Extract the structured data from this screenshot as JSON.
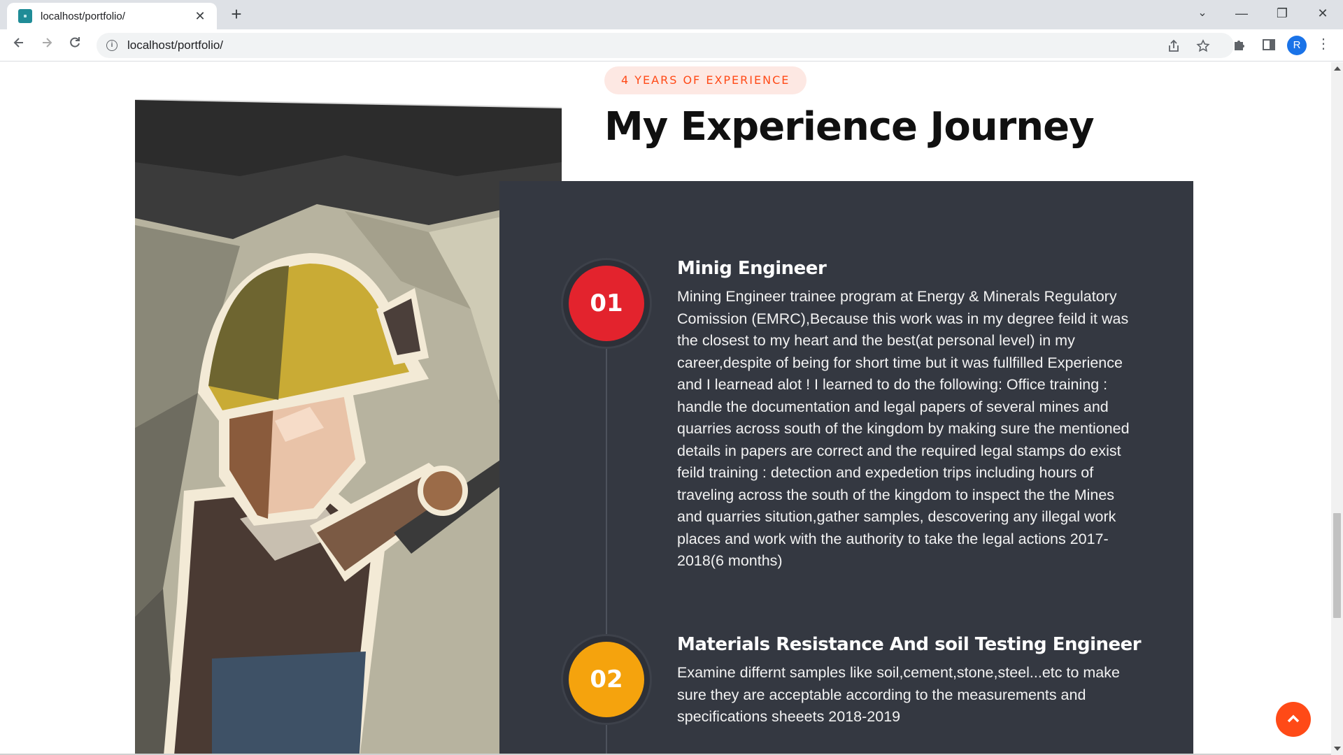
{
  "browser": {
    "tab_title": "localhost/portfolio/",
    "tab_close": "✕",
    "new_tab": "+",
    "url": "localhost/portfolio/",
    "profile_initial": "R",
    "controls": {
      "minimize": "—",
      "restore": "❐",
      "close": "✕",
      "tab_search": "⌄"
    }
  },
  "section": {
    "eyebrow": "4 YEARS OF EXPERIENCE",
    "title": "My Experience Journey",
    "accent_color": "#ff4a17",
    "panel_color": "#343841"
  },
  "timeline": [
    {
      "number": "01",
      "color": "#e3232d",
      "title": "Minig Engineer",
      "description": "Mining Engineer trainee program at Energy & Minerals Regulatory Comission (EMRC),Because this work was in my degree feild it was the closest to my heart and the best(at personal level) in my career,despite of being for short time but it was fullfilled Experience and I learnead alot ! I learned to do the following: Office training : handle the documentation and legal papers of several mines and quarries across south of the kingdom by making sure the mentioned details in papers are correct and the required legal stamps do exist feild training : detection and expedetion trips including hours of traveling across the south of the kingdom to inspect the the Mines and quarries sitution,gather samples, descovering any illegal work places and work with the authority to take the legal actions 2017-2018(6 months)"
    },
    {
      "number": "02",
      "color": "#f5a30d",
      "title": "Materials Resistance And soil Testing Engineer",
      "description": "Examine differnt samples like soil,cement,stone,steel...etc to make sure they are acceptable according to the measurements and specifications sheeets 2018-2019"
    }
  ],
  "back_to_top_icon": "chevron-up"
}
